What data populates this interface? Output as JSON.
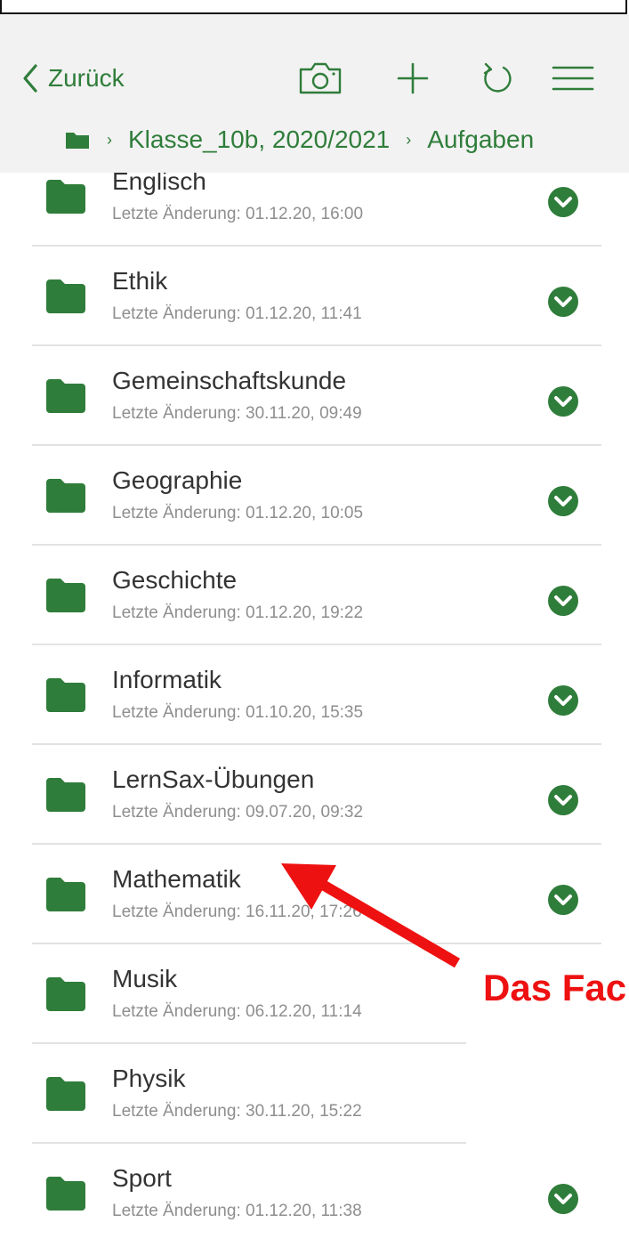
{
  "header": {
    "back_label": "Zurück",
    "icons": [
      "camera-icon",
      "plus-icon",
      "refresh-icon",
      "menu-icon"
    ]
  },
  "breadcrumb": {
    "items": [
      "Klasse_10b, 2020/2021",
      "Aufgaben"
    ]
  },
  "folders": [
    {
      "name": "Englisch",
      "modified": "Letzte Änderung: 01.12.20, 16:00",
      "synced": true
    },
    {
      "name": "Ethik",
      "modified": "Letzte Änderung: 01.12.20, 11:41",
      "synced": true
    },
    {
      "name": "Gemeinschaftskunde",
      "modified": "Letzte Änderung: 30.11.20, 09:49",
      "synced": true
    },
    {
      "name": "Geographie",
      "modified": "Letzte Änderung: 01.12.20, 10:05",
      "synced": true
    },
    {
      "name": "Geschichte",
      "modified": "Letzte Änderung: 01.12.20, 19:22",
      "synced": true
    },
    {
      "name": "Informatik",
      "modified": "Letzte Änderung: 01.10.20, 15:35",
      "synced": true
    },
    {
      "name": "LernSax-Übungen",
      "modified": "Letzte Änderung: 09.07.20, 09:32",
      "synced": true
    },
    {
      "name": "Mathematik",
      "modified": "Letzte Änderung: 16.11.20, 17:26",
      "synced": true
    },
    {
      "name": "Musik",
      "modified": "Letzte Änderung: 06.12.20, 11:14",
      "synced": false
    },
    {
      "name": "Physik",
      "modified": "Letzte Änderung: 30.11.20, 15:22",
      "synced": false
    },
    {
      "name": "Sport",
      "modified": "Letzte Änderung: 01.12.20, 11:38",
      "synced": true
    }
  ],
  "annotation": {
    "text": "Das Fach",
    "color": "#ee1111"
  },
  "colors": {
    "accent": "#2f7d3a"
  }
}
